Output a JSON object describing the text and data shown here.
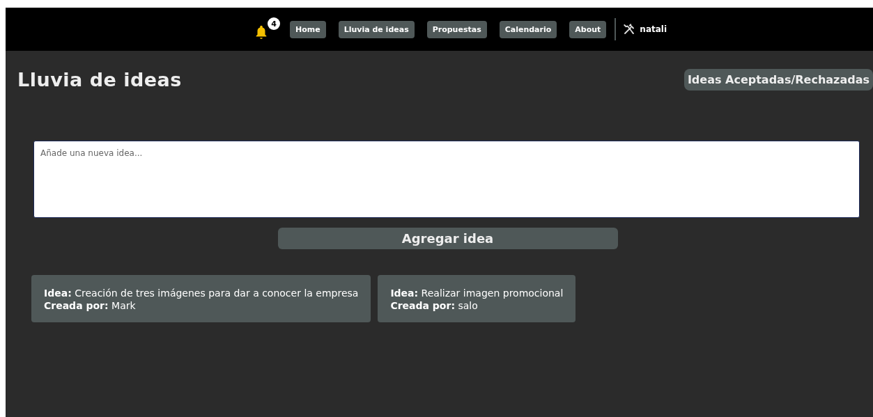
{
  "navbar": {
    "notifications": "4",
    "links": [
      "Home",
      "Lluvia de ideas",
      "Propuestas",
      "Calendario",
      "About"
    ],
    "user": "natali"
  },
  "page": {
    "title": "Lluvia de ideas",
    "history_button": "Ideas Aceptadas/Rechazadas"
  },
  "new_idea": {
    "placeholder": "Añade una nueva idea...",
    "submit": "Agregar idea"
  },
  "ideas": [
    {
      "idea": "**Idea:** Creación de tres imágenes para dar a conocer la empresa",
      "author": "**Creada por:** Mark"
    },
    {
      "idea": "**Idea:** Realizar imagen promocional",
      "author": "**Creada por:** salo"
    }
  ]
}
